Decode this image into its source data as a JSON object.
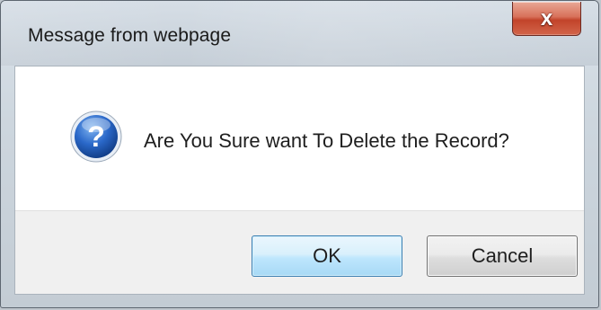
{
  "dialog": {
    "title": "Message from webpage",
    "close_label": "x",
    "message": "Are You Sure want To Delete the Record?",
    "icon": "question-icon",
    "buttons": {
      "ok_label": "OK",
      "cancel_label": "Cancel"
    }
  },
  "colors": {
    "ok_border": "#3c7fb1",
    "close_red": "#c2432a",
    "icon_blue": "#1f5fbf"
  }
}
